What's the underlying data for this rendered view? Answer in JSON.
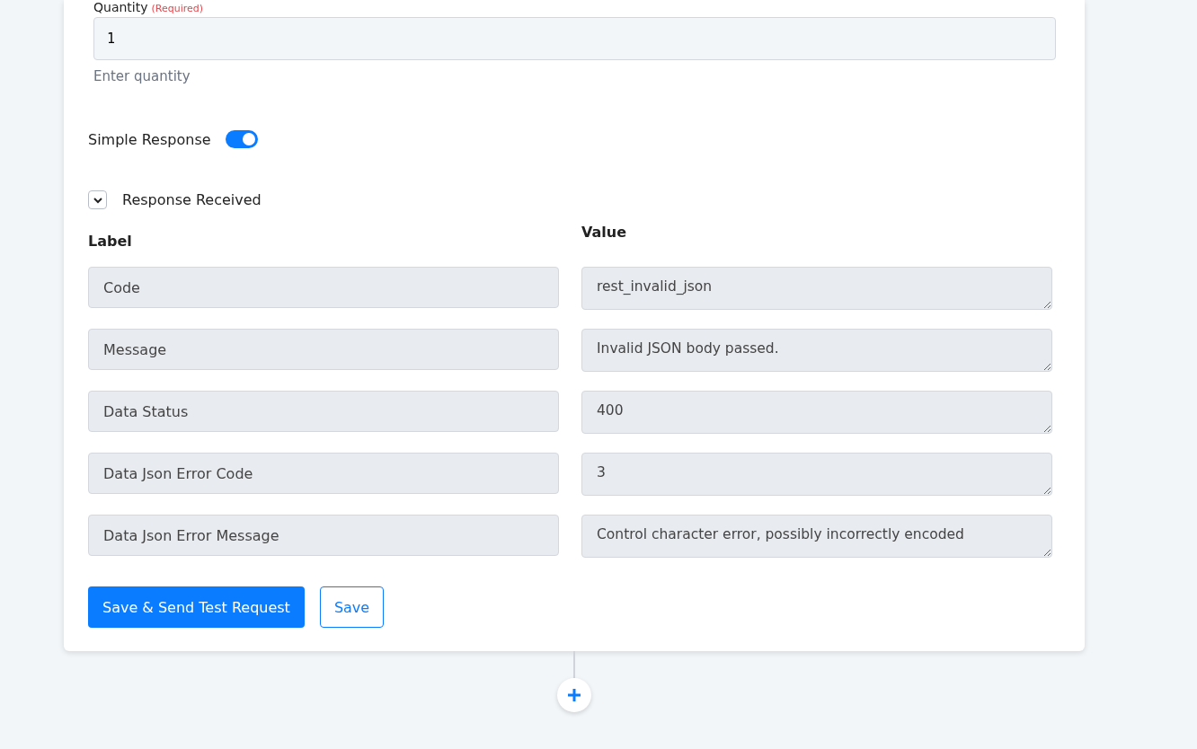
{
  "quantity": {
    "label": "Quantity",
    "required": "(Required)",
    "value": "1",
    "hint": "Enter quantity"
  },
  "simple_response": {
    "label": "Simple Response",
    "on": true
  },
  "response_section": {
    "title": "Response Received",
    "expanded": true
  },
  "columns": {
    "label": "Label",
    "value": "Value"
  },
  "rows": [
    {
      "label": "Code",
      "value": "rest_invalid_json"
    },
    {
      "label": "Message",
      "value": "Invalid JSON body passed."
    },
    {
      "label": "Data Status",
      "value": "400"
    },
    {
      "label": "Data Json Error Code",
      "value": "3"
    },
    {
      "label": "Data Json Error Message",
      "value": "Control character error, possibly incorrectly encoded"
    }
  ],
  "buttons": {
    "primary": "Save & Send Test Request",
    "secondary": "Save"
  }
}
